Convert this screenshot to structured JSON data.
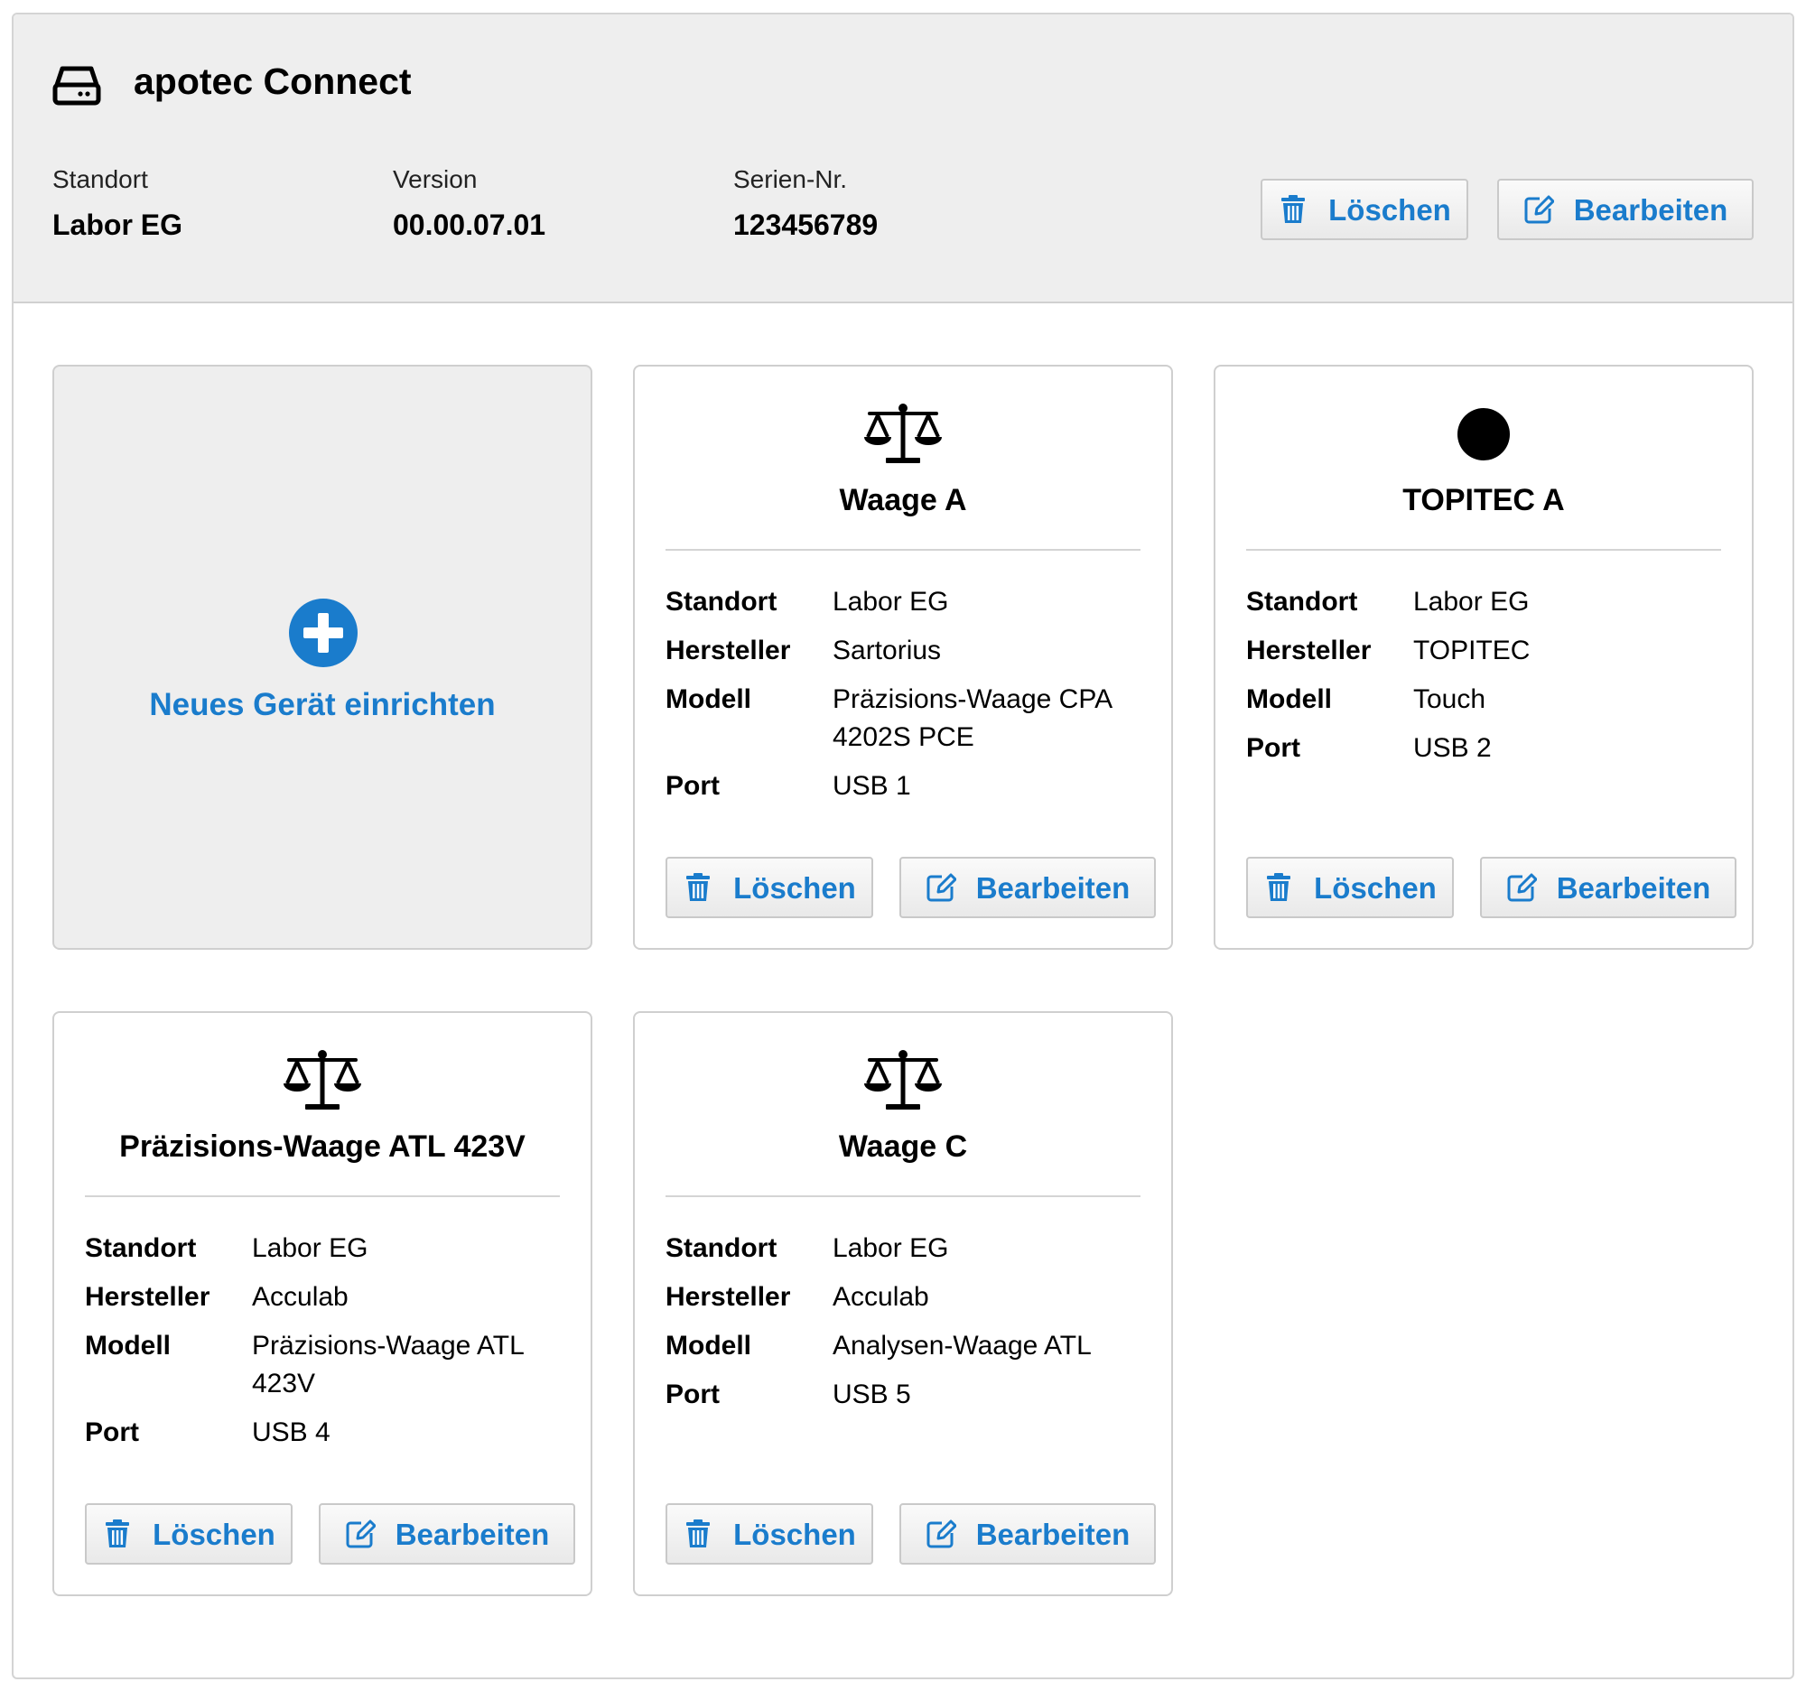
{
  "header": {
    "title": "apotec Connect",
    "icon": "hard-drive-icon",
    "standort_label": "Standort",
    "standort_value": "Labor EG",
    "version_label": "Version",
    "version_value": "00.00.07.01",
    "serial_label": "Serien-Nr.",
    "serial_value": "123456789",
    "delete_label": "Löschen",
    "edit_label": "Bearbeiten"
  },
  "add_device": {
    "label": "Neues Gerät einrichten",
    "icon": "plus-circle-icon"
  },
  "labels": {
    "standort": "Standort",
    "hersteller": "Hersteller",
    "modell": "Modell",
    "port": "Port",
    "delete": "Löschen",
    "edit": "Bearbeiten"
  },
  "devices": [
    {
      "icon": "balance-scale-icon",
      "title": "Waage A",
      "standort": "Labor EG",
      "hersteller": "Sartorius",
      "modell": "Präzisions-Waage CPA 4202S PCE",
      "port": "USB 1"
    },
    {
      "icon": "filled-circle-icon",
      "title": "TOPITEC A",
      "standort": "Labor EG",
      "hersteller": "TOPITEC",
      "modell": "Touch",
      "port": "USB 2"
    },
    {
      "icon": "balance-scale-icon",
      "title": "Präzisions-Waage ATL 423V",
      "standort": "Labor EG",
      "hersteller": "Acculab",
      "modell": "Präzisions-Waage ATL 423V",
      "port": "USB 4"
    },
    {
      "icon": "balance-scale-icon",
      "title": "Waage C",
      "standort": "Labor EG",
      "hersteller": "Acculab",
      "modell": "Analysen-Waage ATL",
      "port": "USB 5"
    }
  ],
  "colors": {
    "accent": "#1a7ccc",
    "header_bg": "#eeeeee",
    "border": "#cfcfcf"
  }
}
